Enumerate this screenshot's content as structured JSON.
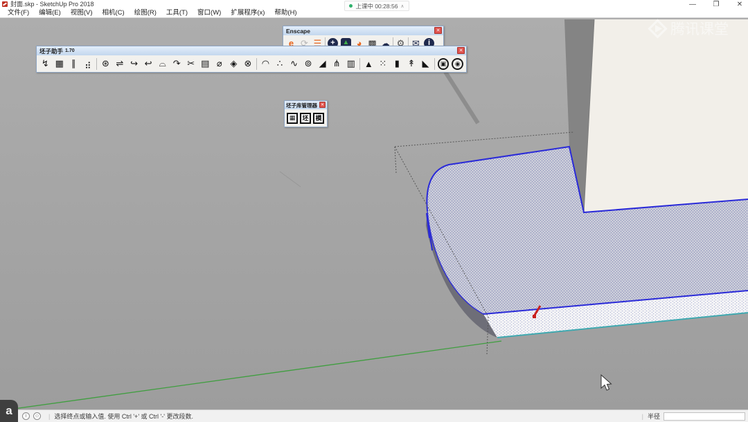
{
  "window": {
    "title": "封面.skp - SketchUp Pro 2018",
    "controls": {
      "minimize": "—",
      "restore": "❐",
      "close": "✕"
    }
  },
  "recording_pill": {
    "status": "上课中",
    "time": "00:28:56",
    "chevron": "∧"
  },
  "menu": {
    "items": [
      {
        "label": "文件(F)"
      },
      {
        "label": "编辑(E)"
      },
      {
        "label": "视图(V)"
      },
      {
        "label": "相机(C)"
      },
      {
        "label": "绘图(R)"
      },
      {
        "label": "工具(T)"
      },
      {
        "label": "窗口(W)"
      },
      {
        "label": "扩展程序(x)"
      },
      {
        "label": "帮助(H)"
      }
    ]
  },
  "toolbars": {
    "enscape": {
      "title": "Enscape",
      "close": "✕",
      "icons": [
        {
          "cls": "ens-icon",
          "name": "enscape-logo-icon",
          "glyph": "e",
          "color": "#e8641a",
          "weight": "bold"
        },
        {
          "cls": "ens-icon",
          "name": "sync-icon",
          "glyph": "⟳",
          "color": "#b8b8b8"
        },
        {
          "cls": "ens-icon",
          "name": "export-layers-icon",
          "glyph": "☰",
          "color": "#e8641a"
        },
        {
          "cls": "ens-sep"
        },
        {
          "cls": "ens-icon circle",
          "name": "add-asset-icon",
          "glyph": "+",
          "color": "#ffffff",
          "bg": "#202a4d"
        },
        {
          "cls": "ens-icon sq",
          "name": "asset-library-icon",
          "glyph": "▲",
          "color": "#3fae49",
          "bg": "#202a4d"
        },
        {
          "cls": "ens-icon",
          "name": "material-library-icon",
          "glyph": "◕",
          "color": "#e8641a"
        },
        {
          "cls": "ens-icon",
          "name": "material-id-icon",
          "glyph": "▩",
          "color": "#2b2b2b"
        },
        {
          "cls": "ens-icon",
          "name": "cloud-upload-icon",
          "glyph": "☁",
          "color": "#202a4d"
        },
        {
          "cls": "ens-sep"
        },
        {
          "cls": "ens-icon",
          "name": "settings-gear-icon",
          "glyph": "⚙",
          "color": "#4a4a4a"
        },
        {
          "cls": "ens-sep"
        },
        {
          "cls": "ens-icon",
          "name": "feedback-mail-icon",
          "glyph": "✉",
          "color": "#202a4d"
        },
        {
          "cls": "ens-icon circle",
          "name": "about-info-icon",
          "glyph": "i",
          "color": "#ffffff",
          "bg": "#202a4d"
        }
      ]
    },
    "pizi_assistant": {
      "title": "坯子助手",
      "version": "1.70",
      "close": "✕",
      "icons": [
        {
          "cls": "pz-glyph",
          "name": "pizi-tool-icon",
          "glyph": "↯"
        },
        {
          "cls": "pz-glyph",
          "name": "pizi-tool-icon",
          "glyph": "▦"
        },
        {
          "cls": "pz-glyph",
          "name": "pizi-tool-icon",
          "glyph": "∥"
        },
        {
          "cls": "pz-glyph",
          "name": "pizi-tool-icon",
          "glyph": "⣴"
        },
        {
          "cls": "pz-sep"
        },
        {
          "cls": "pz-glyph",
          "name": "pizi-tool-icon",
          "glyph": "⊛"
        },
        {
          "cls": "pz-glyph",
          "name": "pizi-tool-icon",
          "glyph": "⇌"
        },
        {
          "cls": "pz-glyph",
          "name": "pizi-tool-icon",
          "glyph": "↪"
        },
        {
          "cls": "pz-glyph",
          "name": "pizi-tool-icon",
          "glyph": "↩"
        },
        {
          "cls": "pz-glyph",
          "name": "pizi-tool-icon",
          "glyph": "⌓"
        },
        {
          "cls": "pz-glyph",
          "name": "pizi-tool-icon",
          "glyph": "↷"
        },
        {
          "cls": "pz-glyph",
          "name": "pizi-tool-icon",
          "glyph": "✂"
        },
        {
          "cls": "pz-glyph",
          "name": "pizi-tool-icon",
          "glyph": "▤"
        },
        {
          "cls": "pz-glyph",
          "name": "pizi-tool-icon",
          "glyph": "⌀"
        },
        {
          "cls": "pz-glyph",
          "name": "pizi-tool-icon",
          "glyph": "◈"
        },
        {
          "cls": "pz-glyph",
          "name": "pizi-tool-icon",
          "glyph": "⊗"
        },
        {
          "cls": "pz-sep"
        },
        {
          "cls": "pz-glyph",
          "name": "pizi-tool-icon",
          "glyph": "◠"
        },
        {
          "cls": "pz-glyph",
          "name": "pizi-tool-icon",
          "glyph": "∴"
        },
        {
          "cls": "pz-glyph",
          "name": "pizi-tool-icon",
          "glyph": "∿"
        },
        {
          "cls": "pz-glyph",
          "name": "pizi-tool-icon",
          "glyph": "⊚"
        },
        {
          "cls": "pz-glyph",
          "name": "pizi-tool-icon",
          "glyph": "◢"
        },
        {
          "cls": "pz-glyph",
          "name": "pizi-tool-icon",
          "glyph": "⋔"
        },
        {
          "cls": "pz-glyph",
          "name": "pizi-tool-icon",
          "glyph": "▥"
        },
        {
          "cls": "pz-sep"
        },
        {
          "cls": "pz-glyph",
          "name": "pizi-tool-icon",
          "glyph": "▲"
        },
        {
          "cls": "pz-glyph",
          "name": "pizi-tool-icon",
          "glyph": "⁙"
        },
        {
          "cls": "pz-glyph",
          "name": "pizi-tool-icon",
          "glyph": "▮"
        },
        {
          "cls": "pz-glyph",
          "name": "pizi-tool-icon",
          "glyph": "↟"
        },
        {
          "cls": "pz-glyph",
          "name": "pizi-tool-icon",
          "glyph": "◣"
        },
        {
          "cls": "pz-sep"
        },
        {
          "cls": "pz-round",
          "name": "pizi-round-button",
          "glyph": "▣"
        },
        {
          "cls": "pz-round",
          "name": "pizi-round-button",
          "glyph": "◉"
        }
      ]
    },
    "pizi_library": {
      "title": "坯子库管理器",
      "close": "✕",
      "icons": [
        {
          "cls": "lib-icon",
          "name": "library-grid-icon",
          "glyph": "▦"
        },
        {
          "cls": "lib-icon",
          "name": "library-pi-icon",
          "glyph": "坯"
        },
        {
          "cls": "lib-icon",
          "name": "library-model-icon",
          "glyph": "模"
        }
      ]
    }
  },
  "viewport": {
    "watermark": "腾讯课堂",
    "badge": "a"
  },
  "statusbar": {
    "info_icon": "i",
    "account_icon": "☺",
    "message": "选择终点或输入值. 使用 Ctrl '+' 或 Ctrl '-' 更改段数.",
    "measure_label": "半径",
    "measure_value": ""
  },
  "colors": {
    "selection_blue": "#2a2ad8",
    "edge_cyan": "#3fa9b0",
    "axis_green": "#3f9e3f",
    "highlight_red": "#c9201d",
    "background_gray": "#a9a9a9",
    "wall_white": "#f2efe9",
    "wall_side_gray": "#848484",
    "fillet_dark": "#6e6e78",
    "stipple_base": "#c7c9d7",
    "stipple_dot": "#8287b8"
  }
}
